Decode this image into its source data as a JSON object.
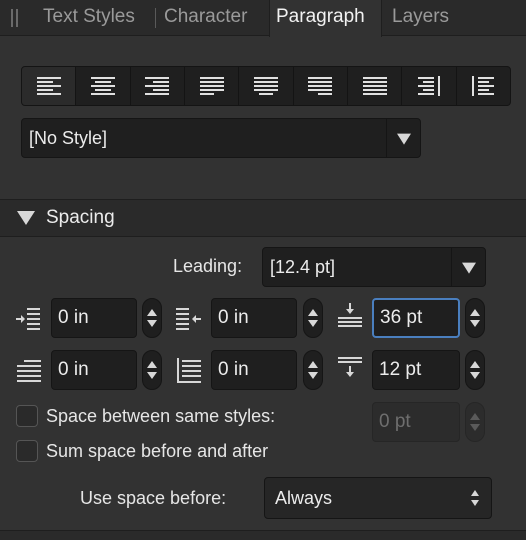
{
  "tabs": [
    {
      "label": "Text Styles"
    },
    {
      "label": "Character"
    },
    {
      "label": "Paragraph"
    },
    {
      "label": "Layers"
    }
  ],
  "style": {
    "value": "[No Style]"
  },
  "spacing": {
    "title": "Spacing",
    "leading_label": "Leading:",
    "leading_value": "[12.4 pt]",
    "left_indent": "0 in",
    "right_indent": "0 in",
    "space_before": "36 pt",
    "first_line_indent": "0 in",
    "last_line_indent": "0 in",
    "space_after": "12 pt",
    "same_styles_label": "Space between same styles:",
    "same_styles_value": "0 pt",
    "sum_label": "Sum space before and after",
    "use_space_label": "Use space before:",
    "use_space_value": "Always"
  },
  "colors": {
    "panel_bg": "#323232",
    "field_bg": "#1f1f1f",
    "focus": "#4a7fbf"
  },
  "icons": [
    "align-left-icon",
    "align-center-icon",
    "align-right-icon",
    "justify-left-icon",
    "justify-center-icon",
    "justify-right-icon",
    "justify-all-icon",
    "align-toward-spine-icon",
    "align-away-spine-icon",
    "left-indent-icon",
    "right-indent-icon",
    "space-before-icon",
    "first-line-indent-icon",
    "last-line-indent-icon",
    "space-after-icon"
  ]
}
